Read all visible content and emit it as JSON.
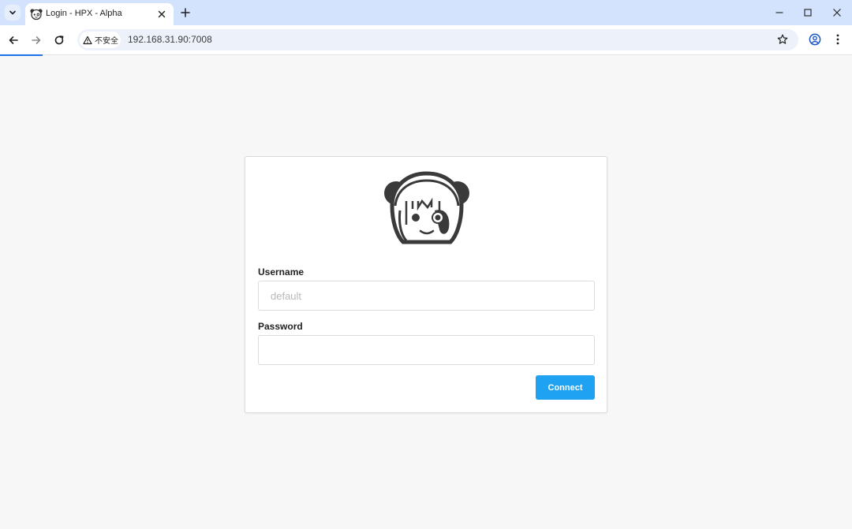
{
  "browser": {
    "tab": {
      "title": "Login - HPX - Alpha",
      "favicon": "panda-face-icon"
    },
    "address": {
      "security_label": "不安全",
      "url": "192.168.31.90:7008"
    },
    "icons": {
      "tab_search": "chevron-down-icon",
      "tab_close": "close-icon",
      "new_tab": "plus-icon",
      "minimize": "minimize-icon",
      "maximize": "maximize-icon",
      "close_window": "close-icon",
      "back": "back-arrow-icon",
      "forward": "forward-arrow-icon",
      "reload": "reload-icon",
      "warning": "warning-triangle-icon",
      "bookmark": "star-icon",
      "profile": "profile-icon",
      "menu": "kebab-menu-icon"
    },
    "colors": {
      "tabstrip": "#d3e3fd",
      "loading_bar": "#1a73e8"
    }
  },
  "login": {
    "logo": "panda-face-icon",
    "username_label": "Username",
    "username_placeholder": "default",
    "username_value": "",
    "password_label": "Password",
    "password_value": "",
    "connect_label": "Connect",
    "colors": {
      "button": "#1fa2f1",
      "page_background": "#f7f7f7"
    }
  }
}
